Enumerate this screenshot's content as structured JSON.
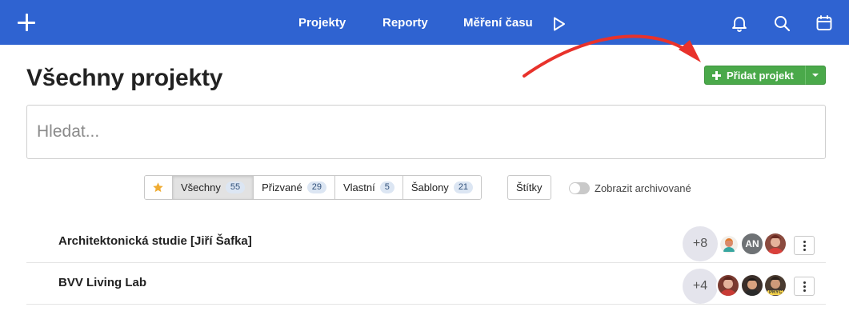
{
  "navbar": {
    "links": [
      "Projekty",
      "Reporty",
      "Měření času"
    ],
    "icons": [
      "plus-icon",
      "play-icon",
      "bell-icon",
      "search-icon",
      "calendar-icon"
    ],
    "background": "#2f63d1"
  },
  "page": {
    "title": "Všechny projekty"
  },
  "add_button": {
    "label": "Přidat projekt",
    "color": "#4aa94a"
  },
  "search": {
    "placeholder": "Hledat..."
  },
  "filters": [
    {
      "label": "Všechny",
      "count": "55",
      "active": true
    },
    {
      "label": "Přizvané",
      "count": "29",
      "active": false
    },
    {
      "label": "Vlastní",
      "count": "5",
      "active": false
    },
    {
      "label": "Šablony",
      "count": "21",
      "active": false
    }
  ],
  "tags_label": "Štítky",
  "archive_toggle": {
    "label": "Zobrazit archivované",
    "on": false
  },
  "projects": [
    {
      "name": "Architektonická studie [Jiří Šafka]",
      "extra_members": "+8",
      "avatars": [
        "avatar-photo",
        "AN",
        "avatar-photo"
      ]
    },
    {
      "name": "BVV Living Lab",
      "extra_members": "+4",
      "avatars": [
        "avatar-photo",
        "avatar-photo",
        "avatar-photo"
      ],
      "away_badge": "PRYČ"
    }
  ],
  "annotation_color": "#e8322b"
}
